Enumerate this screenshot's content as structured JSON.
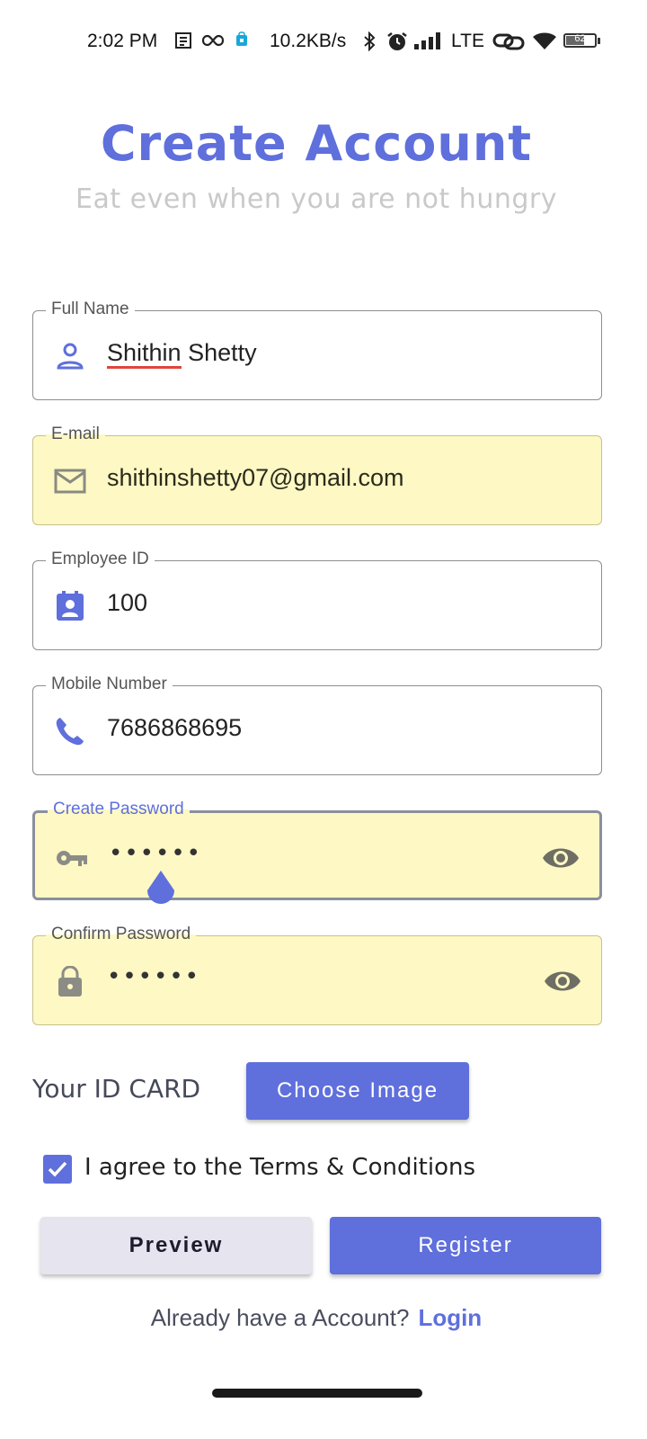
{
  "status_bar": {
    "time": "2:02 PM",
    "speed": "10.2KB/s",
    "network": "LTE",
    "battery": "62",
    "icons": [
      "notes-icon",
      "infinity-icon",
      "app-icon",
      "bluetooth-icon",
      "alarm-icon",
      "signal-icon",
      "link-icon",
      "wifi-icon",
      "battery-icon"
    ]
  },
  "header": {
    "title": "Create Account",
    "subtitle": "Eat even when you are not hungry"
  },
  "fields": {
    "full_name": {
      "label": "Full Name",
      "value_first": "Shithin",
      "value_rest": " Shetty",
      "icon": "person-icon"
    },
    "email": {
      "label": "E-mail",
      "value": "shithinshetty07@gmail.com",
      "icon": "mail-icon"
    },
    "employee_id": {
      "label": "Employee ID",
      "value": "100",
      "icon": "badge-icon"
    },
    "mobile": {
      "label": "Mobile Number",
      "value": "7686868695",
      "icon": "phone-icon"
    },
    "create_password": {
      "label": "Create Password",
      "value": "••••••",
      "icon": "key-icon",
      "toggle": "eye-icon"
    },
    "confirm_password": {
      "label": "Confirm Password",
      "value": "••••••",
      "icon": "lock-icon",
      "toggle": "eye-icon"
    }
  },
  "id_card": {
    "label": "Your ID CARD",
    "button": "Choose Image"
  },
  "terms": {
    "checked": true,
    "label": "I agree to the Terms & Conditions"
  },
  "actions": {
    "preview": "Preview",
    "register": "Register"
  },
  "login": {
    "question": "Already have a Account?",
    "link": "Login"
  },
  "colors": {
    "accent": "#5f6fdc",
    "autofill": "#fdf8c4",
    "subtitle": "#c9c9c9"
  }
}
